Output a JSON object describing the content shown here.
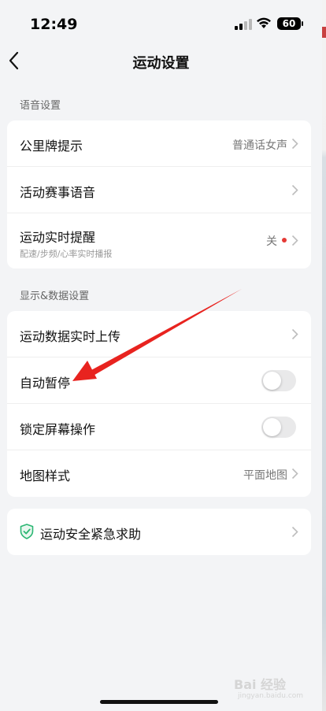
{
  "status_bar": {
    "time": "12:49",
    "battery": "60"
  },
  "nav": {
    "title": "运动设置",
    "back_icon": "chevron-left-icon"
  },
  "sections": {
    "voice": {
      "label": "语音设置",
      "rows": {
        "km_marker": {
          "title": "公里牌提示",
          "value": "普通话女声"
        },
        "event_voice": {
          "title": "活动赛事语音"
        },
        "realtime_reminder": {
          "title": "运动实时提醒",
          "subtitle": "配速/步频/心率实时播报",
          "value": "关"
        }
      }
    },
    "display": {
      "label": "显示&数据设置",
      "rows": {
        "realtime_upload": {
          "title": "运动数据实时上传"
        },
        "auto_pause": {
          "title": "自动暂停",
          "toggle_on": false
        },
        "lock_screen": {
          "title": "锁定屏幕操作",
          "toggle_on": false
        },
        "map_style": {
          "title": "地图样式",
          "value": "平面地图"
        }
      }
    },
    "safety": {
      "rows": {
        "emergency": {
          "title": "运动安全紧急求助",
          "icon": "shield-check-icon"
        }
      }
    }
  },
  "watermark": {
    "text": "Bai 经验",
    "sub": "jingyan.baidu.com"
  },
  "colors": {
    "background": "#f3f4f6",
    "card": "#ffffff",
    "accent_green": "#2bb673",
    "annotation_red": "#e8231f",
    "notification_dot": "#e53935",
    "toggle_off": "#e9e9ea"
  }
}
